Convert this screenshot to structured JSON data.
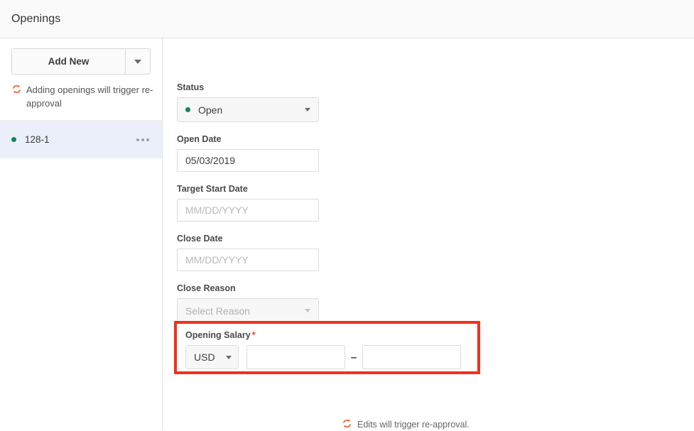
{
  "header": {
    "title": "Openings"
  },
  "sidebar": {
    "add_new_label": "Add New",
    "add_new_caret_icon": "chevron-down-icon",
    "note": {
      "icon": "sync-reapproval-icon",
      "text": "Adding openings will trigger re-approval"
    },
    "openings": [
      {
        "id": "128-1",
        "status_color": "#16835a",
        "menu_icon": "ellipsis-horizontal-icon"
      }
    ]
  },
  "form": {
    "status": {
      "label": "Status",
      "value": "Open",
      "dot_color": "#16835a",
      "caret_icon": "chevron-down-icon"
    },
    "open_date": {
      "label": "Open Date",
      "value": "05/03/2019",
      "placeholder": "MM/DD/YYYY"
    },
    "target_start_date": {
      "label": "Target Start Date",
      "value": "",
      "placeholder": "MM/DD/YYYY"
    },
    "close_date": {
      "label": "Close Date",
      "value": "",
      "placeholder": "MM/DD/YYYY"
    },
    "close_reason": {
      "label": "Close Reason",
      "placeholder": "Select Reason",
      "caret_icon": "chevron-down-icon",
      "disabled": true
    },
    "opening_salary": {
      "label": "Opening Salary",
      "required_marker": "*",
      "currency": "USD",
      "currency_caret_icon": "chevron-down-icon",
      "min_value": "",
      "min_placeholder": "",
      "separator": "–",
      "max_value": "",
      "max_placeholder": "",
      "highlight_color": "#f2301a"
    },
    "edits_note": {
      "icon": "sync-reapproval-icon",
      "text": "Edits will trigger re-approval."
    }
  },
  "colors": {
    "accent_orange": "#ef5a28",
    "highlight_red": "#f2301a",
    "status_green": "#16835a",
    "row_highlight": "#eaeff9",
    "header_bg": "#fafafa"
  }
}
